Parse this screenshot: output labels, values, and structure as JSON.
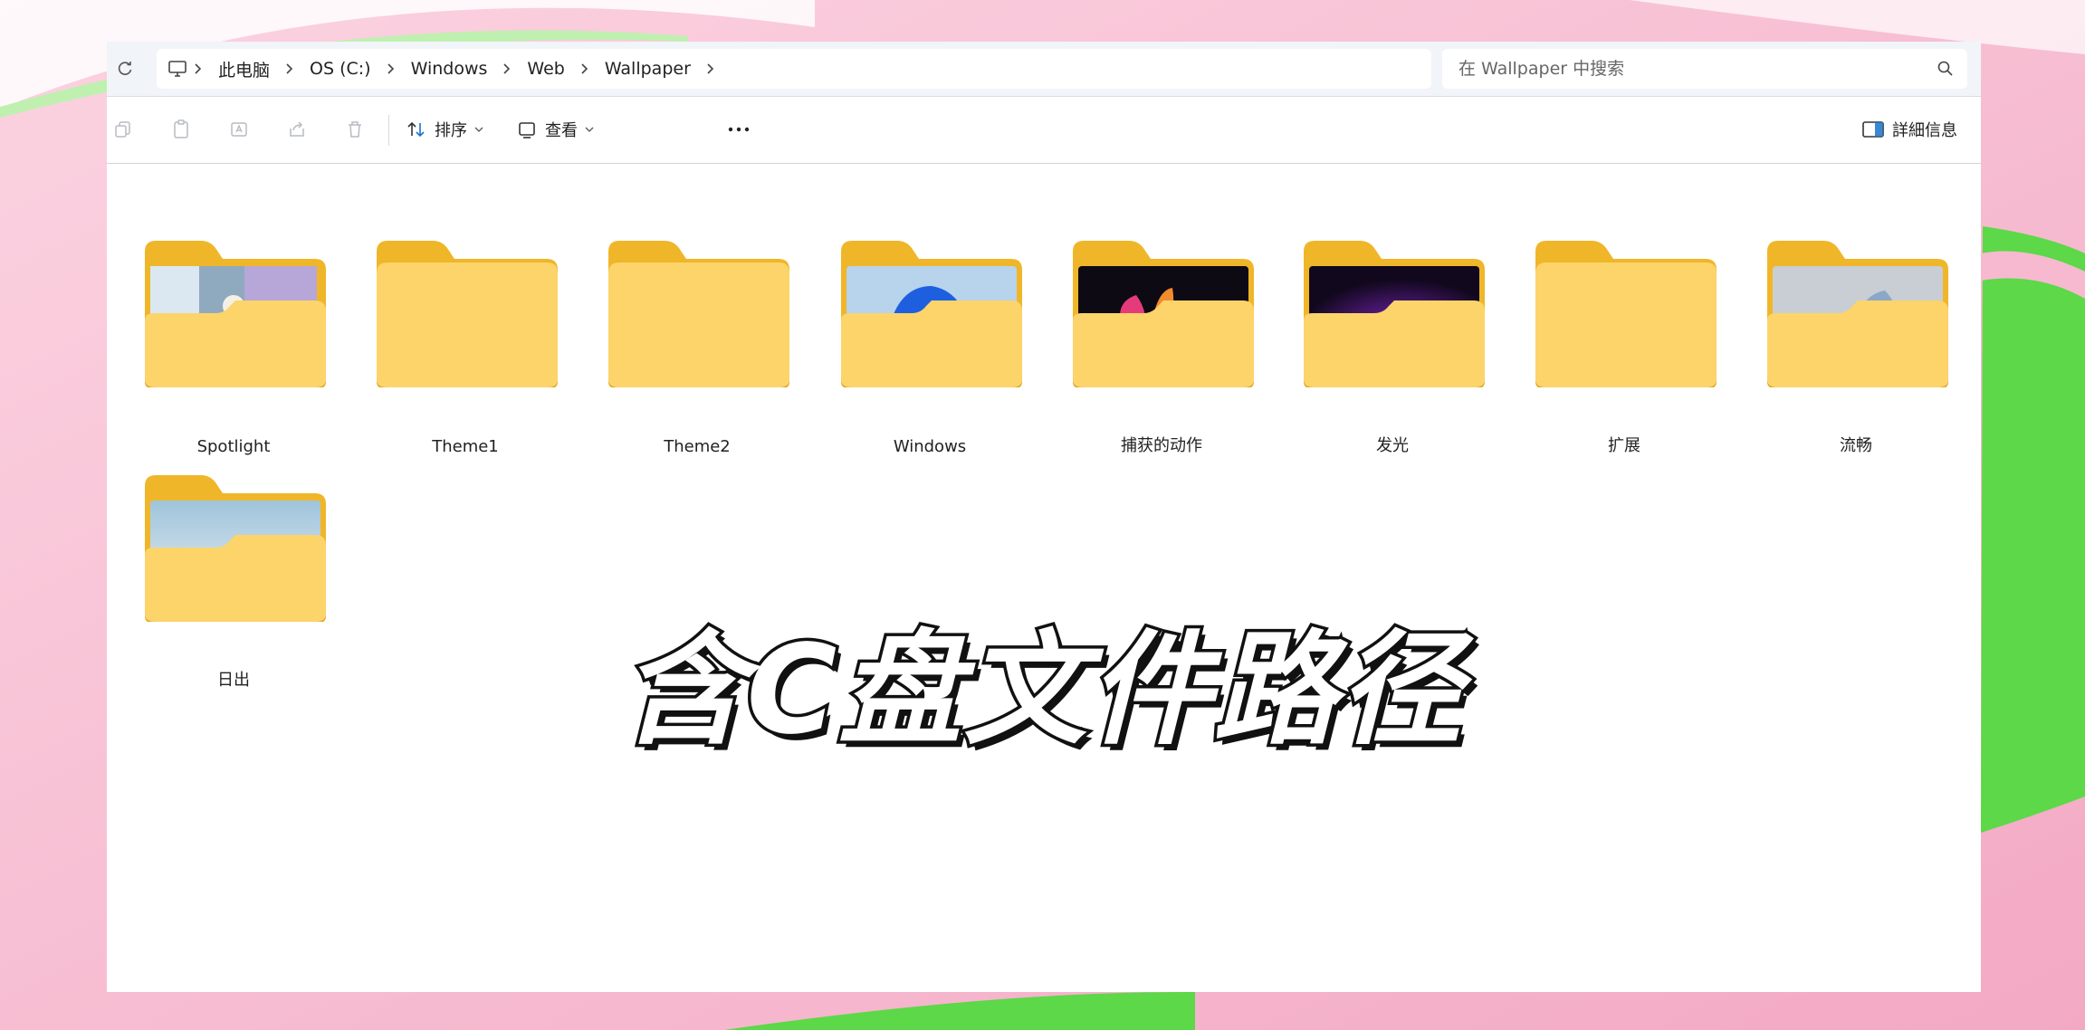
{
  "addressbar": {
    "breadcrumb": [
      {
        "label": "此电脑"
      },
      {
        "label": "OS (C:)"
      },
      {
        "label": "Windows"
      },
      {
        "label": "Web"
      },
      {
        "label": "Wallpaper"
      }
    ],
    "search_placeholder": "在 Wallpaper 中搜索"
  },
  "toolbar": {
    "sort_label": "排序",
    "view_label": "查看",
    "details_label": "詳細信息"
  },
  "folders": [
    {
      "name": "Spotlight",
      "thumbnail": "scenic-collage"
    },
    {
      "name": "Theme1",
      "thumbnail": "none"
    },
    {
      "name": "Theme2",
      "thumbnail": "none"
    },
    {
      "name": "Windows",
      "thumbnail": "blue-bloom"
    },
    {
      "name": "捕获的动作",
      "thumbnail": "colorful-petals"
    },
    {
      "name": "发光",
      "thumbnail": "purple-glow"
    },
    {
      "name": "扩展",
      "thumbnail": "none"
    },
    {
      "name": "流畅",
      "thumbnail": "silver-flow"
    },
    {
      "name": "日出",
      "thumbnail": "sunrise-landscape"
    }
  ],
  "overlay": {
    "title": "含C盘文件路径"
  },
  "colors": {
    "folder_back": "#F0B629",
    "folder_front": "#FCD46A",
    "accent_green": "#5CD848",
    "background_pink": "#F7B9CF"
  }
}
